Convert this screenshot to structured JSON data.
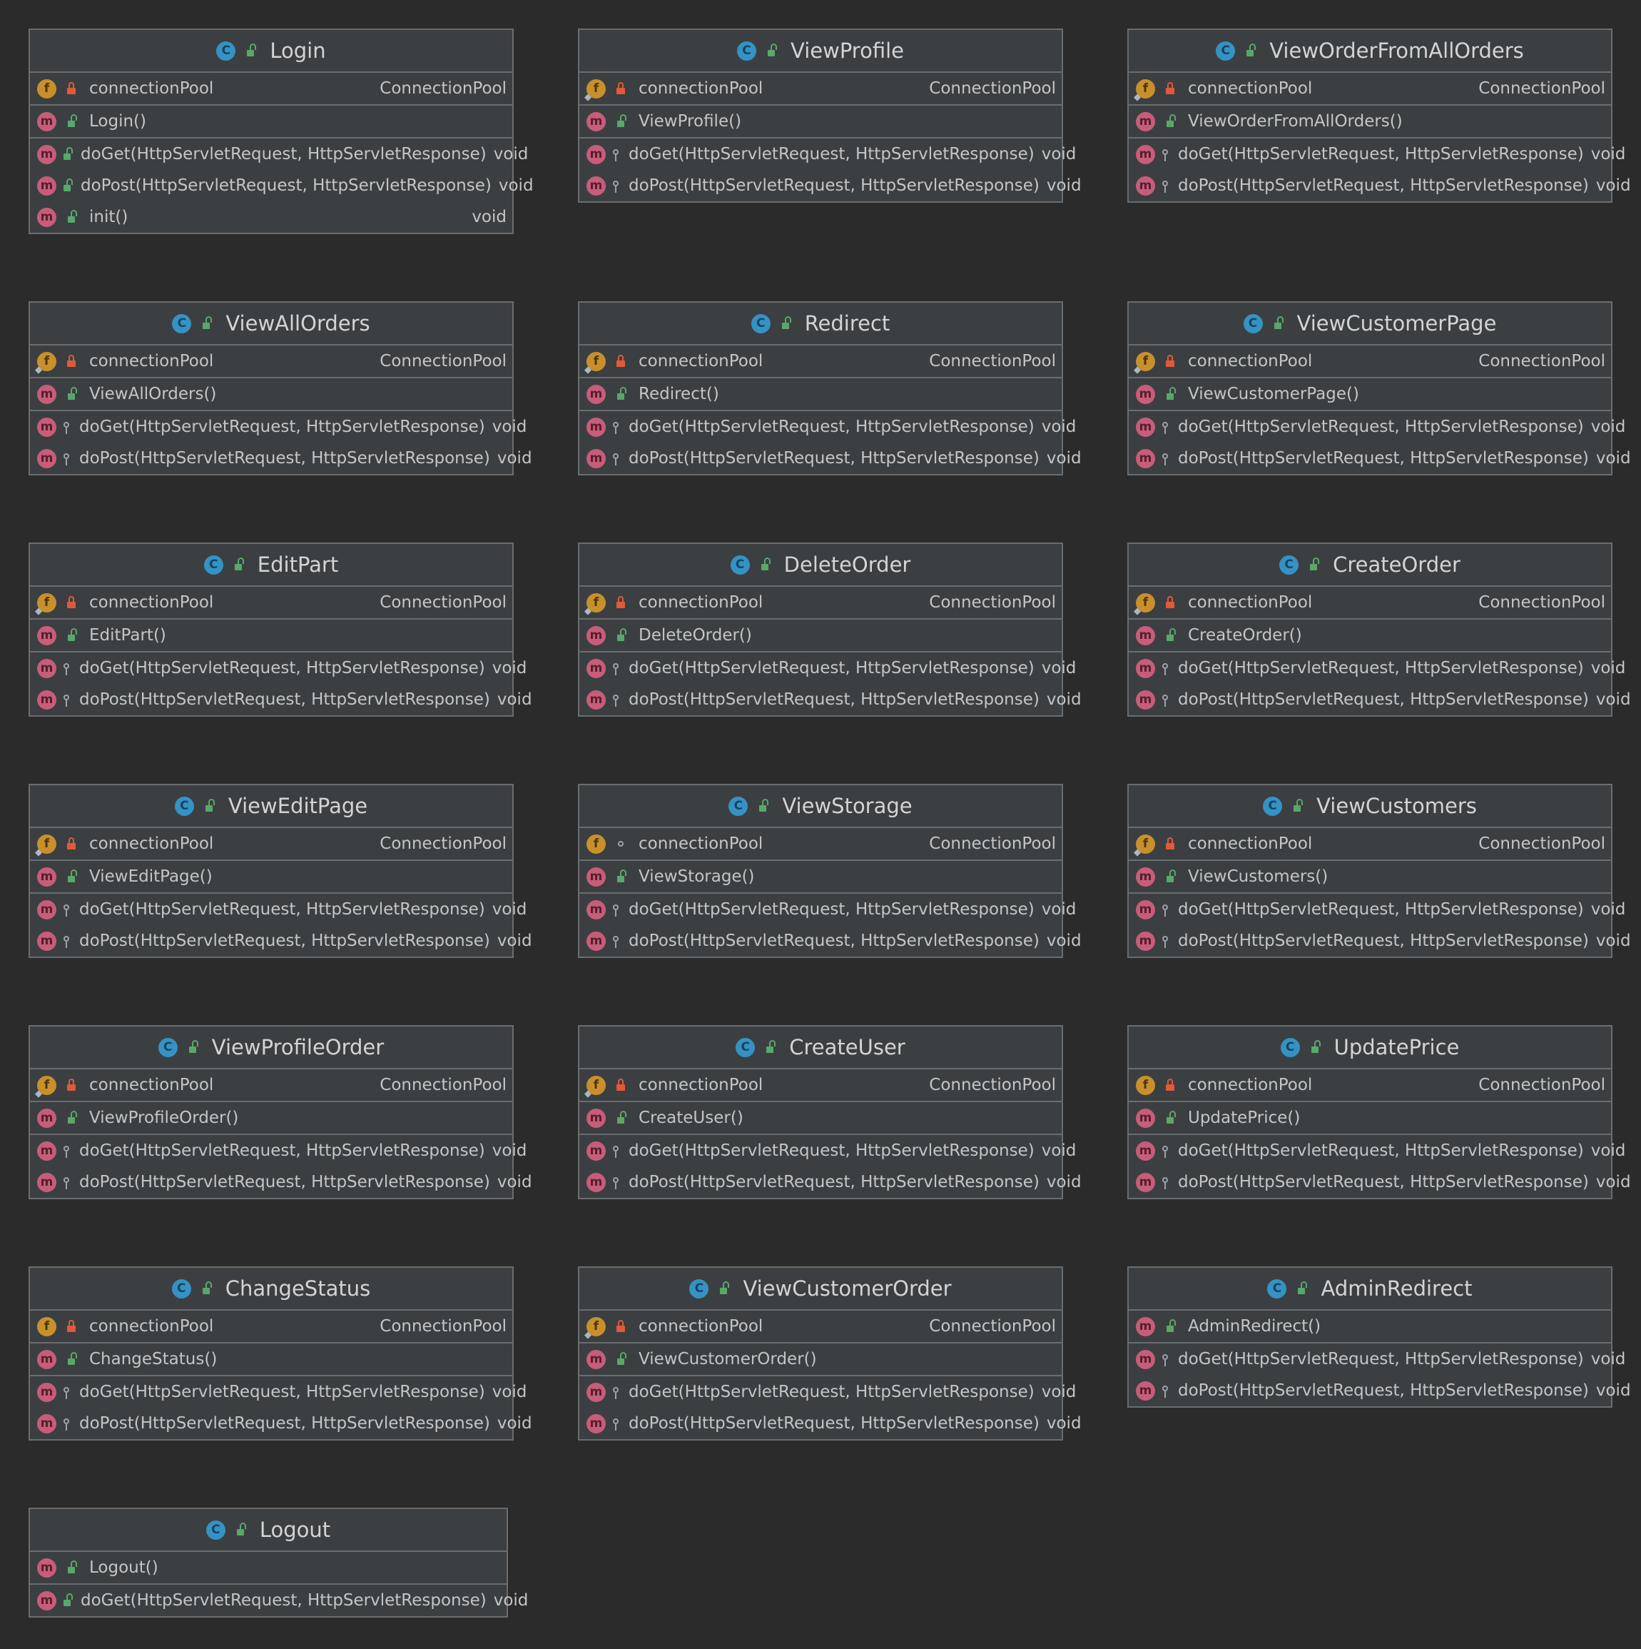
{
  "classes": [
    {
      "name": "Login",
      "fields": [
        {
          "name": "connectionPool",
          "type": "ConnectionPool",
          "vis": "private",
          "pinned": false
        }
      ],
      "constructors": [
        {
          "name": "Login()",
          "vis": "public"
        }
      ],
      "methods": [
        {
          "name": "doGet(HttpServletRequest, HttpServletResponse)",
          "type": "void",
          "vis": "public"
        },
        {
          "name": "doPost(HttpServletRequest, HttpServletResponse)",
          "type": "void",
          "vis": "public"
        },
        {
          "name": "init()",
          "type": "void",
          "vis": "public"
        }
      ]
    },
    {
      "name": "ViewProfile",
      "fields": [
        {
          "name": "connectionPool",
          "type": "ConnectionPool",
          "vis": "private",
          "pinned": true
        }
      ],
      "constructors": [
        {
          "name": "ViewProfile()",
          "vis": "public"
        }
      ],
      "methods": [
        {
          "name": "doGet(HttpServletRequest, HttpServletResponse)",
          "type": "void",
          "vis": "protected"
        },
        {
          "name": "doPost(HttpServletRequest, HttpServletResponse)",
          "type": "void",
          "vis": "protected"
        }
      ]
    },
    {
      "name": "ViewOrderFromAllOrders",
      "fields": [
        {
          "name": "connectionPool",
          "type": "ConnectionPool",
          "vis": "private",
          "pinned": true
        }
      ],
      "constructors": [
        {
          "name": "ViewOrderFromAllOrders()",
          "vis": "public"
        }
      ],
      "methods": [
        {
          "name": "doGet(HttpServletRequest, HttpServletResponse)",
          "type": "void",
          "vis": "protected"
        },
        {
          "name": "doPost(HttpServletRequest, HttpServletResponse)",
          "type": "void",
          "vis": "protected"
        }
      ]
    },
    {
      "name": "ViewAllOrders",
      "fields": [
        {
          "name": "connectionPool",
          "type": "ConnectionPool",
          "vis": "private",
          "pinned": true
        }
      ],
      "constructors": [
        {
          "name": "ViewAllOrders()",
          "vis": "public"
        }
      ],
      "methods": [
        {
          "name": "doGet(HttpServletRequest, HttpServletResponse)",
          "type": "void",
          "vis": "protected"
        },
        {
          "name": "doPost(HttpServletRequest, HttpServletResponse)",
          "type": "void",
          "vis": "protected"
        }
      ]
    },
    {
      "name": "Redirect",
      "fields": [
        {
          "name": "connectionPool",
          "type": "ConnectionPool",
          "vis": "private",
          "pinned": true
        }
      ],
      "constructors": [
        {
          "name": "Redirect()",
          "vis": "public"
        }
      ],
      "methods": [
        {
          "name": "doGet(HttpServletRequest, HttpServletResponse)",
          "type": "void",
          "vis": "protected"
        },
        {
          "name": "doPost(HttpServletRequest, HttpServletResponse)",
          "type": "void",
          "vis": "protected"
        }
      ]
    },
    {
      "name": "ViewCustomerPage",
      "fields": [
        {
          "name": "connectionPool",
          "type": "ConnectionPool",
          "vis": "private",
          "pinned": true
        }
      ],
      "constructors": [
        {
          "name": "ViewCustomerPage()",
          "vis": "public"
        }
      ],
      "methods": [
        {
          "name": "doGet(HttpServletRequest, HttpServletResponse)",
          "type": "void",
          "vis": "protected"
        },
        {
          "name": "doPost(HttpServletRequest, HttpServletResponse)",
          "type": "void",
          "vis": "protected"
        }
      ]
    },
    {
      "name": "EditPart",
      "fields": [
        {
          "name": "connectionPool",
          "type": "ConnectionPool",
          "vis": "private",
          "pinned": true
        }
      ],
      "constructors": [
        {
          "name": "EditPart()",
          "vis": "public"
        }
      ],
      "methods": [
        {
          "name": "doGet(HttpServletRequest, HttpServletResponse)",
          "type": "void",
          "vis": "protected"
        },
        {
          "name": "doPost(HttpServletRequest, HttpServletResponse)",
          "type": "void",
          "vis": "protected"
        }
      ]
    },
    {
      "name": "DeleteOrder",
      "fields": [
        {
          "name": "connectionPool",
          "type": "ConnectionPool",
          "vis": "private",
          "pinned": true
        }
      ],
      "constructors": [
        {
          "name": "DeleteOrder()",
          "vis": "public"
        }
      ],
      "methods": [
        {
          "name": "doGet(HttpServletRequest, HttpServletResponse)",
          "type": "void",
          "vis": "protected"
        },
        {
          "name": "doPost(HttpServletRequest, HttpServletResponse)",
          "type": "void",
          "vis": "protected"
        }
      ]
    },
    {
      "name": "CreateOrder",
      "fields": [
        {
          "name": "connectionPool",
          "type": "ConnectionPool",
          "vis": "private",
          "pinned": true
        }
      ],
      "constructors": [
        {
          "name": "CreateOrder()",
          "vis": "public"
        }
      ],
      "methods": [
        {
          "name": "doGet(HttpServletRequest, HttpServletResponse)",
          "type": "void",
          "vis": "protected"
        },
        {
          "name": "doPost(HttpServletRequest, HttpServletResponse)",
          "type": "void",
          "vis": "protected"
        }
      ]
    },
    {
      "name": "ViewEditPage",
      "fields": [
        {
          "name": "connectionPool",
          "type": "ConnectionPool",
          "vis": "private",
          "pinned": true
        }
      ],
      "constructors": [
        {
          "name": "ViewEditPage()",
          "vis": "public"
        }
      ],
      "methods": [
        {
          "name": "doGet(HttpServletRequest, HttpServletResponse)",
          "type": "void",
          "vis": "protected"
        },
        {
          "name": "doPost(HttpServletRequest, HttpServletResponse)",
          "type": "void",
          "vis": "protected"
        }
      ]
    },
    {
      "name": "ViewStorage",
      "fields": [
        {
          "name": "connectionPool",
          "type": "ConnectionPool",
          "vis": "package",
          "pinned": false
        }
      ],
      "constructors": [
        {
          "name": "ViewStorage()",
          "vis": "public"
        }
      ],
      "methods": [
        {
          "name": "doGet(HttpServletRequest, HttpServletResponse)",
          "type": "void",
          "vis": "protected"
        },
        {
          "name": "doPost(HttpServletRequest, HttpServletResponse)",
          "type": "void",
          "vis": "protected"
        }
      ]
    },
    {
      "name": "ViewCustomers",
      "fields": [
        {
          "name": "connectionPool",
          "type": "ConnectionPool",
          "vis": "private",
          "pinned": true
        }
      ],
      "constructors": [
        {
          "name": "ViewCustomers()",
          "vis": "public"
        }
      ],
      "methods": [
        {
          "name": "doGet(HttpServletRequest, HttpServletResponse)",
          "type": "void",
          "vis": "protected"
        },
        {
          "name": "doPost(HttpServletRequest, HttpServletResponse)",
          "type": "void",
          "vis": "protected"
        }
      ]
    },
    {
      "name": "ViewProfileOrder",
      "fields": [
        {
          "name": "connectionPool",
          "type": "ConnectionPool",
          "vis": "private",
          "pinned": true
        }
      ],
      "constructors": [
        {
          "name": "ViewProfileOrder()",
          "vis": "public"
        }
      ],
      "methods": [
        {
          "name": "doGet(HttpServletRequest, HttpServletResponse)",
          "type": "void",
          "vis": "protected"
        },
        {
          "name": "doPost(HttpServletRequest, HttpServletResponse)",
          "type": "void",
          "vis": "protected"
        }
      ]
    },
    {
      "name": "CreateUser",
      "fields": [
        {
          "name": "connectionPool",
          "type": "ConnectionPool",
          "vis": "private",
          "pinned": true
        }
      ],
      "constructors": [
        {
          "name": "CreateUser()",
          "vis": "public"
        }
      ],
      "methods": [
        {
          "name": "doGet(HttpServletRequest, HttpServletResponse)",
          "type": "void",
          "vis": "protected"
        },
        {
          "name": "doPost(HttpServletRequest, HttpServletResponse)",
          "type": "void",
          "vis": "protected"
        }
      ]
    },
    {
      "name": "UpdatePrice",
      "fields": [
        {
          "name": "connectionPool",
          "type": "ConnectionPool",
          "vis": "private",
          "pinned": false
        }
      ],
      "constructors": [
        {
          "name": "UpdatePrice()",
          "vis": "public"
        }
      ],
      "methods": [
        {
          "name": "doGet(HttpServletRequest, HttpServletResponse)",
          "type": "void",
          "vis": "protected"
        },
        {
          "name": "doPost(HttpServletRequest, HttpServletResponse)",
          "type": "void",
          "vis": "protected"
        }
      ]
    },
    {
      "name": "ChangeStatus",
      "fields": [
        {
          "name": "connectionPool",
          "type": "ConnectionPool",
          "vis": "private",
          "pinned": false
        }
      ],
      "constructors": [
        {
          "name": "ChangeStatus()",
          "vis": "public"
        }
      ],
      "methods": [
        {
          "name": "doGet(HttpServletRequest, HttpServletResponse)",
          "type": "void",
          "vis": "protected"
        },
        {
          "name": "doPost(HttpServletRequest, HttpServletResponse)",
          "type": "void",
          "vis": "protected"
        }
      ]
    },
    {
      "name": "ViewCustomerOrder",
      "fields": [
        {
          "name": "connectionPool",
          "type": "ConnectionPool",
          "vis": "private",
          "pinned": true
        }
      ],
      "constructors": [
        {
          "name": "ViewCustomerOrder()",
          "vis": "public"
        }
      ],
      "methods": [
        {
          "name": "doGet(HttpServletRequest, HttpServletResponse)",
          "type": "void",
          "vis": "protected"
        },
        {
          "name": "doPost(HttpServletRequest, HttpServletResponse)",
          "type": "void",
          "vis": "protected"
        }
      ]
    },
    {
      "name": "AdminRedirect",
      "fields": [],
      "constructors": [
        {
          "name": "AdminRedirect()",
          "vis": "public"
        }
      ],
      "methods": [
        {
          "name": "doGet(HttpServletRequest, HttpServletResponse)",
          "type": "void",
          "vis": "protected"
        },
        {
          "name": "doPost(HttpServletRequest, HttpServletResponse)",
          "type": "void",
          "vis": "protected"
        }
      ]
    },
    {
      "name": "Logout",
      "fields": [],
      "constructors": [
        {
          "name": "Logout()",
          "vis": "public"
        }
      ],
      "methods": [
        {
          "name": "doGet(HttpServletRequest, HttpServletResponse)",
          "type": "void",
          "vis": "public"
        }
      ]
    }
  ],
  "icons": {
    "class": "C",
    "field": "f",
    "method": "m"
  },
  "colors": {
    "background": "#2b2b2b",
    "card": "#3c3f41",
    "border": "#6a6d70",
    "class_badge": "#3592c4",
    "field_badge": "#c8902c",
    "method_badge": "#c75d7a",
    "public": "#59a869",
    "private": "#e05a3a"
  }
}
